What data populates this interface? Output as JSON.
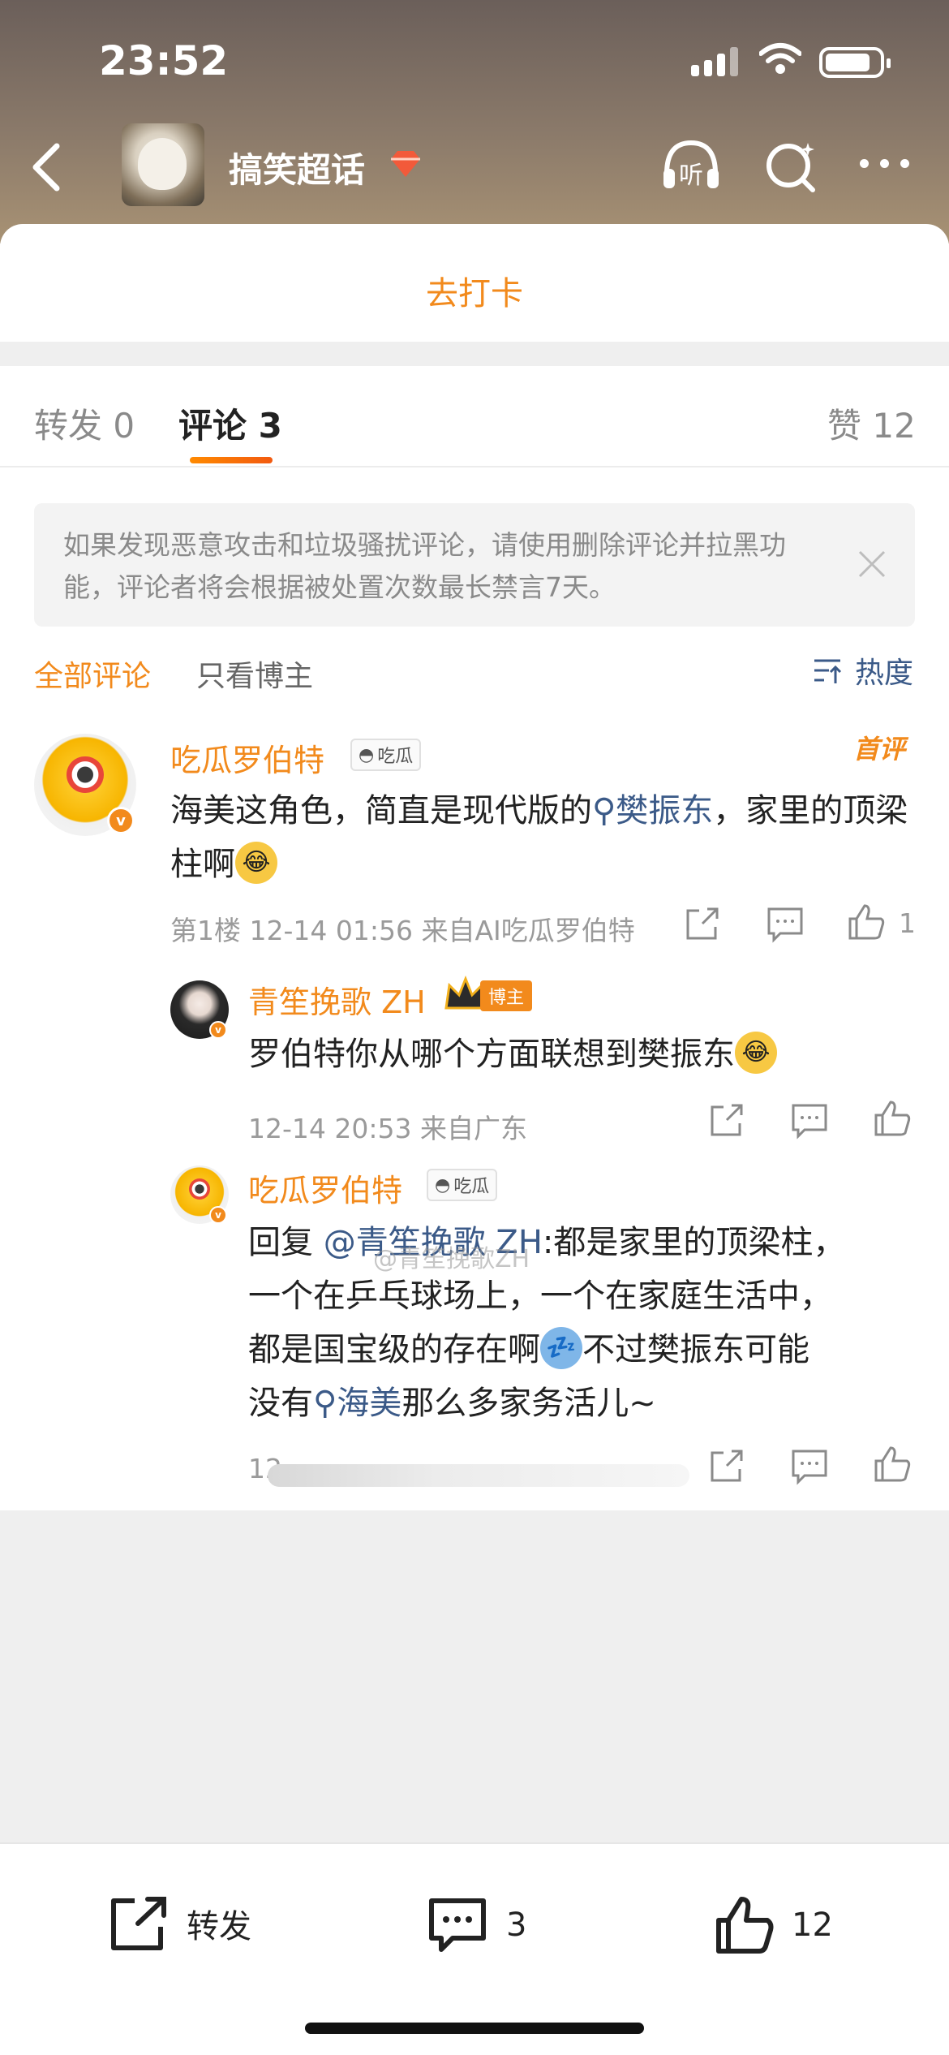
{
  "status_bar": {
    "time": "23:52"
  },
  "nav": {
    "title": "搞笑超话",
    "listen_label": "听"
  },
  "checkin": {
    "label": "去打卡"
  },
  "tabs": {
    "repost": "转发 0",
    "comment": "评论 3",
    "like": "赞 12"
  },
  "notice": {
    "text": "如果发现恶意攻击和垃圾骚扰评论，请使用删除评论并拉黑功能，评论者将会根据被处置次数最长禁言7天。"
  },
  "filters": {
    "all": "全部评论",
    "blogger_only": "只看博主",
    "sort": "热度"
  },
  "comments": {
    "c1": {
      "name": "吃瓜罗伯特",
      "tag": "吃瓜",
      "top_label": "首评",
      "text_a": "海美这角色，简直是现代版的",
      "link": "樊振东",
      "text_b": "，家里的顶梁柱啊",
      "meta": "第1楼 12-14 01:56 来自AI吃瓜罗伯特",
      "likes": "1"
    },
    "r1": {
      "name": "青笙挽歌 ZH",
      "tag": "博主",
      "text": "罗伯特你从哪个方面联想到樊振东",
      "meta": "12-14 20:53 来自广东"
    },
    "r2": {
      "name": "吃瓜罗伯特",
      "tag": "吃瓜",
      "reply_prefix": "回复 ",
      "mention": "@青笙挽歌 ZH",
      "line1_rest": ":都是家里的顶梁柱，",
      "line2": "一个在乒乓球场上，一个在家庭生活中，",
      "line3": "都是国宝级的存在啊",
      "line3_tail": "不过樊振东可能",
      "line4_pre": "没有",
      "line4_link": "海美",
      "line4_post": "那么多家务活儿~",
      "meta": "12"
    }
  },
  "watermark": "@青笙挽歌ZH",
  "bottom": {
    "repost": "转发",
    "comment_count": "3",
    "like_count": "12"
  }
}
